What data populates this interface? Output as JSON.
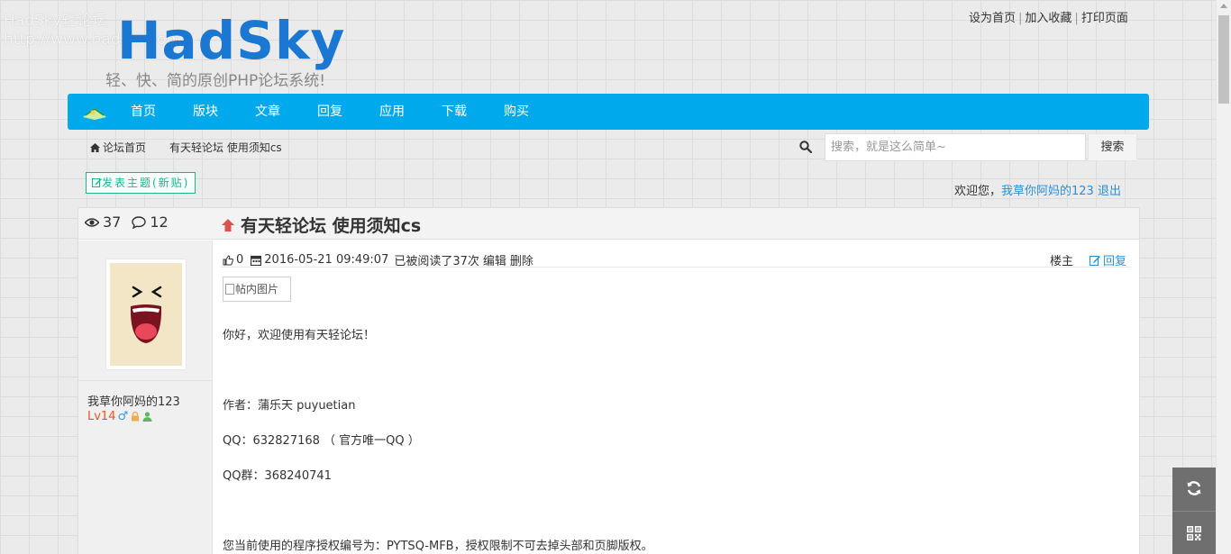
{
  "watermark": {
    "line1": "HadSky轻论坛",
    "line2": "http://www.hadsky.com"
  },
  "header": {
    "logo": "HadSky",
    "slogan": "轻、快、简的原创PHP论坛系统!",
    "top_links": [
      "设为首页",
      "加入收藏",
      "打印页面"
    ]
  },
  "nav": {
    "items": [
      "首页",
      "版块",
      "文章",
      "回复",
      "应用",
      "下载",
      "购买"
    ],
    "brand_color": "#00a9ec"
  },
  "breadcrumb": {
    "home": "论坛首页",
    "current": "有天轻论坛 使用须知cs"
  },
  "search": {
    "placeholder": "搜索，就是这么简单~",
    "button": "搜索"
  },
  "actions": {
    "new_post": "发表主题(新贴)",
    "welcome_prefix": "欢迎您，",
    "username": "我草你阿妈的123",
    "logout": "退出"
  },
  "post": {
    "views": "37",
    "replies": "12",
    "title": "有天轻论坛 使用须知cs",
    "likes": "0",
    "datetime": "2016-05-21 09:49:07",
    "read_info": "已被阅读了37次",
    "edit": "编辑",
    "delete": "删除",
    "floor": "楼主",
    "reply": "回复",
    "image_alt": "帖内图片",
    "author": {
      "name": "我草你阿妈的123",
      "level": "Lv14",
      "gender_icon": "♂"
    },
    "paragraphs": [
      "你好，欢迎使用有天轻论坛！",
      "作者：蒲乐天 puyuetian",
      "QQ：632827168 （ 官方唯一QQ ）",
      "QQ群：368240741",
      "您当前使用的程序授权编号为：PYTSQ-MFB，授权限制不可去掉头部和页脚版权。"
    ]
  }
}
